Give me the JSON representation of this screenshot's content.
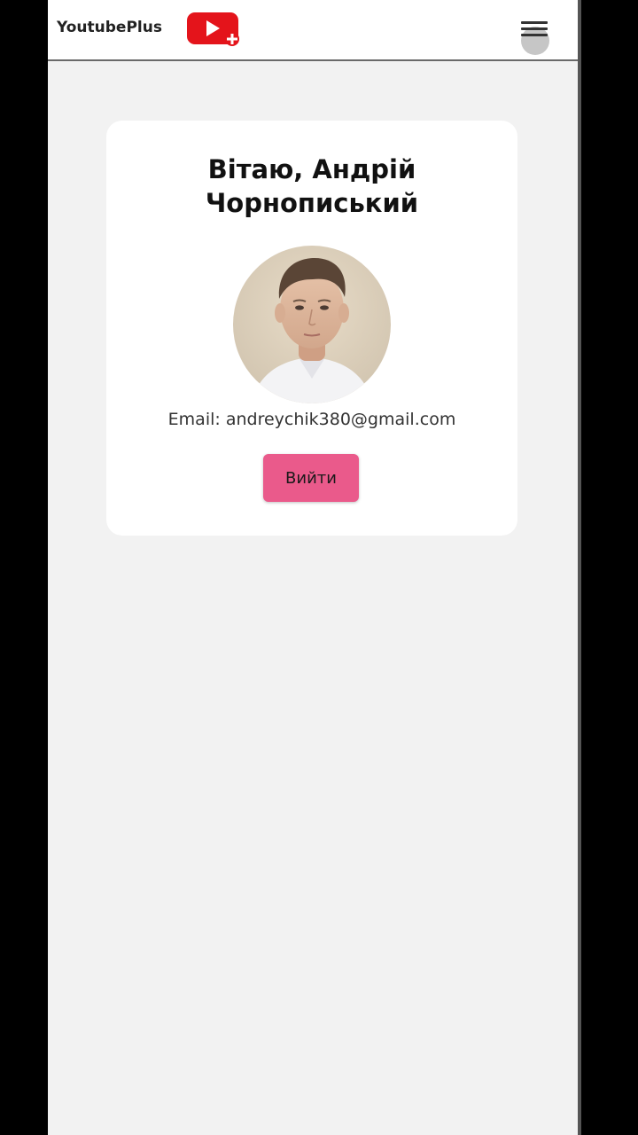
{
  "header": {
    "brand": "YoutubePlus",
    "logo_icon": "youtube-plus-logo-icon",
    "menu_icon": "hamburger-menu-icon"
  },
  "profile": {
    "greeting": "Вітаю, Андрій Чорнописький",
    "avatar": "user-avatar",
    "email_label": "Email: andreychik380@gmail.com",
    "logout_label": "Вийти"
  },
  "colors": {
    "logo_red": "#e4141b",
    "logout_button": "#ea5a8b",
    "page_background": "#f2f2f2",
    "card_background": "#ffffff"
  }
}
